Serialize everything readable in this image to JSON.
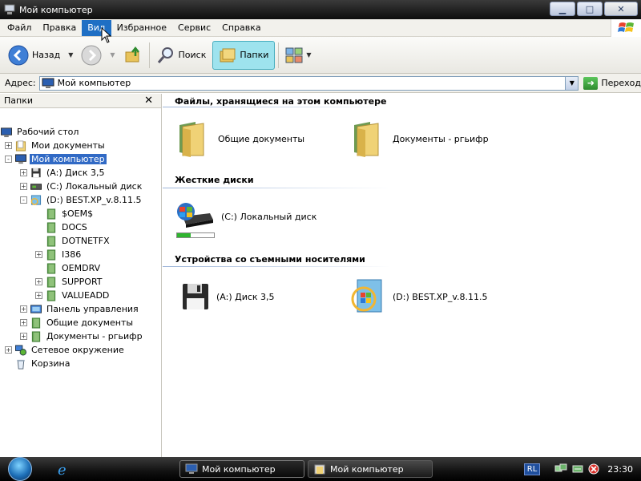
{
  "window": {
    "title": "Мой компьютер"
  },
  "menu": {
    "items": [
      "Файл",
      "Правка",
      "Вид",
      "Избранное",
      "Сервис",
      "Справка"
    ],
    "active_index": 2
  },
  "toolbar": {
    "back_label": "Назад",
    "search_label": "Поиск",
    "folders_label": "Папки"
  },
  "address": {
    "label": "Адрес:",
    "value": "Мой компьютер",
    "go_label": "Переход"
  },
  "folders_pane": {
    "title": "Папки",
    "tree": [
      {
        "label": "Рабочий стол",
        "icon": "desktop-icon",
        "level": 0,
        "expander": ""
      },
      {
        "label": "Мои документы",
        "icon": "documents-folder-icon",
        "level": 1,
        "expander": "+"
      },
      {
        "label": "Мой компьютер",
        "icon": "computer-icon",
        "level": 1,
        "expander": "-",
        "selected": true
      },
      {
        "label": "(A:) Диск 3,5",
        "icon": "floppy-icon",
        "level": 2,
        "expander": "+"
      },
      {
        "label": "(C:) Локальный диск",
        "icon": "hard-drive-icon",
        "level": 2,
        "expander": "+"
      },
      {
        "label": "(D:) BEST.XP_v.8.11.5",
        "icon": "cd-drive-icon",
        "level": 2,
        "expander": "-"
      },
      {
        "label": "$OEM$",
        "icon": "folder-icon",
        "level": 3,
        "expander": ""
      },
      {
        "label": "DOCS",
        "icon": "folder-icon",
        "level": 3,
        "expander": ""
      },
      {
        "label": "DOTNETFX",
        "icon": "folder-icon",
        "level": 3,
        "expander": ""
      },
      {
        "label": "I386",
        "icon": "folder-icon",
        "level": 3,
        "expander": "+"
      },
      {
        "label": "OEMDRV",
        "icon": "folder-icon",
        "level": 3,
        "expander": ""
      },
      {
        "label": "SUPPORT",
        "icon": "folder-icon",
        "level": 3,
        "expander": "+"
      },
      {
        "label": "VALUEADD",
        "icon": "folder-icon",
        "level": 3,
        "expander": "+"
      },
      {
        "label": "Панель управления",
        "icon": "control-panel-icon",
        "level": 2,
        "expander": "+"
      },
      {
        "label": "Общие документы",
        "icon": "folder-icon",
        "level": 2,
        "expander": "+"
      },
      {
        "label": "Документы - ргьифр",
        "icon": "folder-icon",
        "level": 2,
        "expander": "+"
      },
      {
        "label": "Сетевое окружение",
        "icon": "network-icon",
        "level": 1,
        "expander": "+"
      },
      {
        "label": "Корзина",
        "icon": "recycle-bin-icon",
        "level": 1,
        "expander": ""
      }
    ]
  },
  "content": {
    "groups": [
      {
        "title": "Файлы, хранящиеся на этом компьютере",
        "items": [
          {
            "label": "Общие документы",
            "icon": "folder-icon"
          },
          {
            "label": "Документы - ргьифр",
            "icon": "folder-icon"
          }
        ]
      },
      {
        "title": "Жесткие диски",
        "items": [
          {
            "label": "(C:) Локальный диск",
            "icon": "hard-drive-icon",
            "usage": 0.38
          }
        ]
      },
      {
        "title": "Устройства со съемными носителями",
        "items": [
          {
            "label": "(A:) Диск 3,5",
            "icon": "floppy-icon"
          },
          {
            "label": "(D:) BEST.XP_v.8.11.5",
            "icon": "cd-drive-icon"
          }
        ]
      }
    ]
  },
  "taskbar": {
    "tasks": [
      {
        "label": "Мой компьютер",
        "active": true
      },
      {
        "label": "Мой компьютер",
        "active": false
      }
    ],
    "language": "RL",
    "clock": "23:30"
  },
  "colors": {
    "selection": "#316ac5",
    "menu_active": "#1f6fc4",
    "folders_pressed": "#9ee3ee",
    "progress": "#2fb52f"
  }
}
